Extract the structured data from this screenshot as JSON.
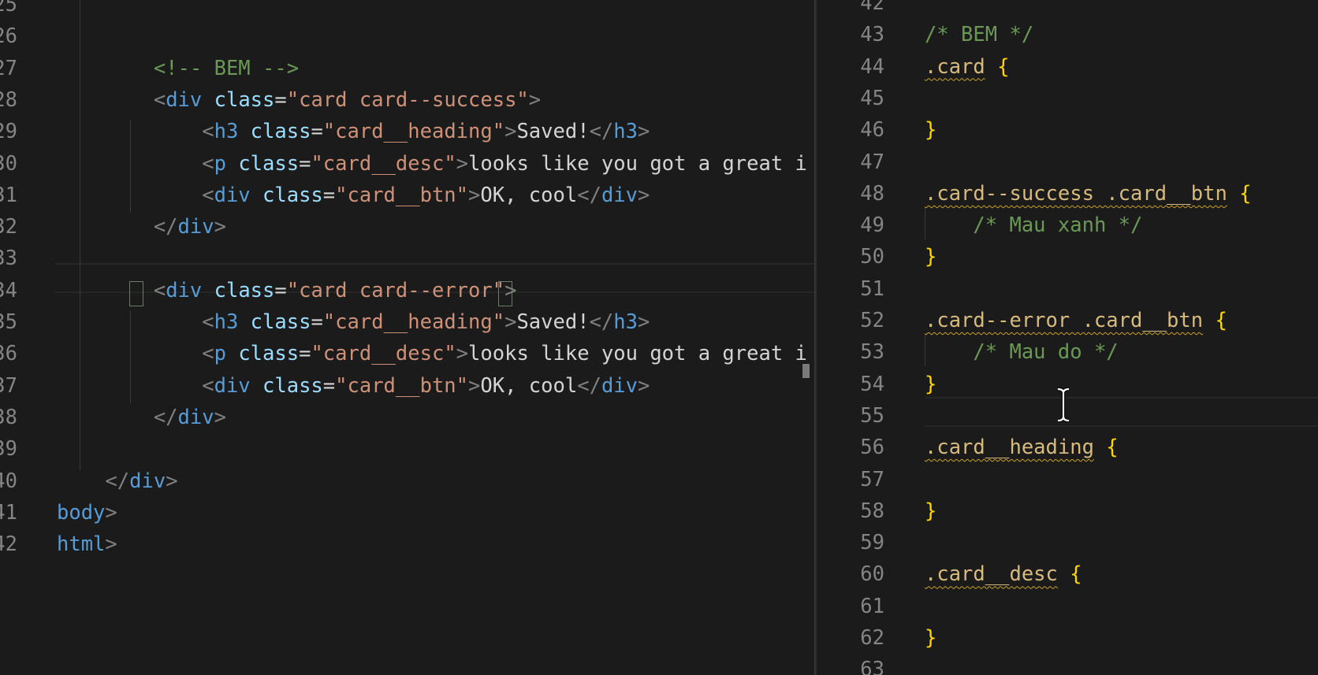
{
  "left_editor": {
    "lines": [
      {
        "num": "25",
        "tokens": []
      },
      {
        "num": "26",
        "tokens": []
      },
      {
        "num": "27",
        "tokens": [
          {
            "t": "        ",
            "c": ""
          },
          {
            "t": "<!-- BEM -->",
            "c": "t-comment"
          }
        ]
      },
      {
        "num": "28",
        "tokens": [
          {
            "t": "        ",
            "c": ""
          },
          {
            "t": "<",
            "c": "t-punct"
          },
          {
            "t": "div",
            "c": "t-tag"
          },
          {
            "t": " ",
            "c": ""
          },
          {
            "t": "class",
            "c": "t-attr"
          },
          {
            "t": "=",
            "c": "t-eq"
          },
          {
            "t": "\"card card--success\"",
            "c": "t-str"
          },
          {
            "t": ">",
            "c": "t-punct"
          }
        ]
      },
      {
        "num": "29",
        "tokens": [
          {
            "t": "            ",
            "c": ""
          },
          {
            "t": "<",
            "c": "t-punct"
          },
          {
            "t": "h3",
            "c": "t-tag"
          },
          {
            "t": " ",
            "c": ""
          },
          {
            "t": "class",
            "c": "t-attr"
          },
          {
            "t": "=",
            "c": "t-eq"
          },
          {
            "t": "\"card__heading\"",
            "c": "t-str"
          },
          {
            "t": ">",
            "c": "t-punct"
          },
          {
            "t": "Saved!",
            "c": "t-text"
          },
          {
            "t": "</",
            "c": "t-punct"
          },
          {
            "t": "h3",
            "c": "t-tag"
          },
          {
            "t": ">",
            "c": "t-punct"
          }
        ]
      },
      {
        "num": "30",
        "tokens": [
          {
            "t": "            ",
            "c": ""
          },
          {
            "t": "<",
            "c": "t-punct"
          },
          {
            "t": "p",
            "c": "t-tag"
          },
          {
            "t": " ",
            "c": ""
          },
          {
            "t": "class",
            "c": "t-attr"
          },
          {
            "t": "=",
            "c": "t-eq"
          },
          {
            "t": "\"card__desc\"",
            "c": "t-str"
          },
          {
            "t": ">",
            "c": "t-punct"
          },
          {
            "t": "looks like you got a great i",
            "c": "t-text"
          }
        ]
      },
      {
        "num": "31",
        "tokens": [
          {
            "t": "            ",
            "c": ""
          },
          {
            "t": "<",
            "c": "t-punct"
          },
          {
            "t": "div",
            "c": "t-tag"
          },
          {
            "t": " ",
            "c": ""
          },
          {
            "t": "class",
            "c": "t-attr"
          },
          {
            "t": "=",
            "c": "t-eq"
          },
          {
            "t": "\"card__btn\"",
            "c": "t-str"
          },
          {
            "t": ">",
            "c": "t-punct"
          },
          {
            "t": "OK, cool",
            "c": "t-text"
          },
          {
            "t": "</",
            "c": "t-punct"
          },
          {
            "t": "div",
            "c": "t-tag"
          },
          {
            "t": ">",
            "c": "t-punct"
          }
        ]
      },
      {
        "num": "32",
        "tokens": [
          {
            "t": "        ",
            "c": ""
          },
          {
            "t": "</",
            "c": "t-punct"
          },
          {
            "t": "div",
            "c": "t-tag"
          },
          {
            "t": ">",
            "c": "t-punct"
          }
        ]
      },
      {
        "num": "33",
        "tokens": []
      },
      {
        "num": "34",
        "tokens": [
          {
            "t": "        ",
            "c": ""
          },
          {
            "t": "<",
            "c": "t-punct"
          },
          {
            "t": "div",
            "c": "t-tag"
          },
          {
            "t": " ",
            "c": ""
          },
          {
            "t": "class",
            "c": "t-attr"
          },
          {
            "t": "=",
            "c": "t-eq"
          },
          {
            "t": "\"card card--error\"",
            "c": "t-str"
          },
          {
            "t": ">",
            "c": "t-punct"
          }
        ]
      },
      {
        "num": "35",
        "tokens": [
          {
            "t": "            ",
            "c": ""
          },
          {
            "t": "<",
            "c": "t-punct"
          },
          {
            "t": "h3",
            "c": "t-tag"
          },
          {
            "t": " ",
            "c": ""
          },
          {
            "t": "class",
            "c": "t-attr"
          },
          {
            "t": "=",
            "c": "t-eq"
          },
          {
            "t": "\"card__heading\"",
            "c": "t-str"
          },
          {
            "t": ">",
            "c": "t-punct"
          },
          {
            "t": "Saved!",
            "c": "t-text"
          },
          {
            "t": "</",
            "c": "t-punct"
          },
          {
            "t": "h3",
            "c": "t-tag"
          },
          {
            "t": ">",
            "c": "t-punct"
          }
        ]
      },
      {
        "num": "36",
        "tokens": [
          {
            "t": "            ",
            "c": ""
          },
          {
            "t": "<",
            "c": "t-punct"
          },
          {
            "t": "p",
            "c": "t-tag"
          },
          {
            "t": " ",
            "c": ""
          },
          {
            "t": "class",
            "c": "t-attr"
          },
          {
            "t": "=",
            "c": "t-eq"
          },
          {
            "t": "\"card__desc\"",
            "c": "t-str"
          },
          {
            "t": ">",
            "c": "t-punct"
          },
          {
            "t": "looks like you got a great i",
            "c": "t-text"
          }
        ]
      },
      {
        "num": "37",
        "tokens": [
          {
            "t": "            ",
            "c": ""
          },
          {
            "t": "<",
            "c": "t-punct"
          },
          {
            "t": "div",
            "c": "t-tag"
          },
          {
            "t": " ",
            "c": ""
          },
          {
            "t": "class",
            "c": "t-attr"
          },
          {
            "t": "=",
            "c": "t-eq"
          },
          {
            "t": "\"card__btn\"",
            "c": "t-str"
          },
          {
            "t": ">",
            "c": "t-punct"
          },
          {
            "t": "OK, cool",
            "c": "t-text"
          },
          {
            "t": "</",
            "c": "t-punct"
          },
          {
            "t": "div",
            "c": "t-tag"
          },
          {
            "t": ">",
            "c": "t-punct"
          }
        ]
      },
      {
        "num": "38",
        "tokens": [
          {
            "t": "        ",
            "c": ""
          },
          {
            "t": "</",
            "c": "t-punct"
          },
          {
            "t": "div",
            "c": "t-tag"
          },
          {
            "t": ">",
            "c": "t-punct"
          }
        ]
      },
      {
        "num": "39",
        "tokens": []
      },
      {
        "num": "40",
        "tokens": [
          {
            "t": "    ",
            "c": ""
          },
          {
            "t": "</",
            "c": "t-punct"
          },
          {
            "t": "div",
            "c": "t-tag"
          },
          {
            "t": ">",
            "c": "t-punct"
          }
        ]
      },
      {
        "num": "41",
        "tokens": [
          {
            "t": "body",
            "c": "t-tag"
          },
          {
            "t": ">",
            "c": "t-punct"
          }
        ]
      },
      {
        "num": "42",
        "tokens": [
          {
            "t": "html",
            "c": "t-tag"
          },
          {
            "t": ">",
            "c": "t-punct"
          }
        ]
      }
    ]
  },
  "right_editor": {
    "lines": [
      {
        "num": "42",
        "tokens": []
      },
      {
        "num": "43",
        "tokens": [
          {
            "t": "/* BEM */",
            "c": "t-comment"
          }
        ]
      },
      {
        "num": "44",
        "tokens": [
          {
            "t": ".card",
            "c": "t-sel squiggle"
          },
          {
            "t": " ",
            "c": ""
          },
          {
            "t": "{",
            "c": "t-brace"
          }
        ]
      },
      {
        "num": "45",
        "tokens": []
      },
      {
        "num": "46",
        "tokens": [
          {
            "t": "}",
            "c": "t-brace"
          }
        ]
      },
      {
        "num": "47",
        "tokens": []
      },
      {
        "num": "48",
        "tokens": [
          {
            "t": ".card--success .card__btn",
            "c": "t-sel squiggle"
          },
          {
            "t": " ",
            "c": ""
          },
          {
            "t": "{",
            "c": "t-brace"
          }
        ]
      },
      {
        "num": "49",
        "tokens": [
          {
            "t": "    ",
            "c": ""
          },
          {
            "t": "/* Mau xanh */",
            "c": "t-comment"
          }
        ]
      },
      {
        "num": "50",
        "tokens": [
          {
            "t": "}",
            "c": "t-brace"
          }
        ]
      },
      {
        "num": "51",
        "tokens": []
      },
      {
        "num": "52",
        "tokens": [
          {
            "t": ".card--error .card__btn",
            "c": "t-sel squiggle"
          },
          {
            "t": " ",
            "c": ""
          },
          {
            "t": "{",
            "c": "t-brace"
          }
        ]
      },
      {
        "num": "53",
        "tokens": [
          {
            "t": "    ",
            "c": ""
          },
          {
            "t": "/* Mau do */",
            "c": "t-comment"
          }
        ]
      },
      {
        "num": "54",
        "tokens": [
          {
            "t": "}",
            "c": "t-brace"
          }
        ]
      },
      {
        "num": "55",
        "tokens": []
      },
      {
        "num": "56",
        "tokens": [
          {
            "t": ".card__heading",
            "c": "t-sel squiggle"
          },
          {
            "t": " ",
            "c": ""
          },
          {
            "t": "{",
            "c": "t-brace"
          }
        ]
      },
      {
        "num": "57",
        "tokens": []
      },
      {
        "num": "58",
        "tokens": [
          {
            "t": "}",
            "c": "t-brace"
          }
        ]
      },
      {
        "num": "59",
        "tokens": []
      },
      {
        "num": "60",
        "tokens": [
          {
            "t": ".card__desc",
            "c": "t-sel squiggle"
          },
          {
            "t": " ",
            "c": ""
          },
          {
            "t": "{",
            "c": "t-brace"
          }
        ]
      },
      {
        "num": "61",
        "tokens": []
      },
      {
        "num": "62",
        "tokens": [
          {
            "t": "}",
            "c": "t-brace"
          }
        ]
      },
      {
        "num": "63",
        "tokens": []
      }
    ]
  },
  "colors": {
    "background": "#1b1b1b",
    "line_number": "#858585",
    "comment": "#6a9955",
    "tag": "#569cd6",
    "attribute": "#9cdcfe",
    "string": "#ce9178",
    "selector": "#d7ba7d",
    "brace": "#ffd700"
  },
  "icons": {
    "text_cursor": "i-beam-cursor-icon"
  }
}
